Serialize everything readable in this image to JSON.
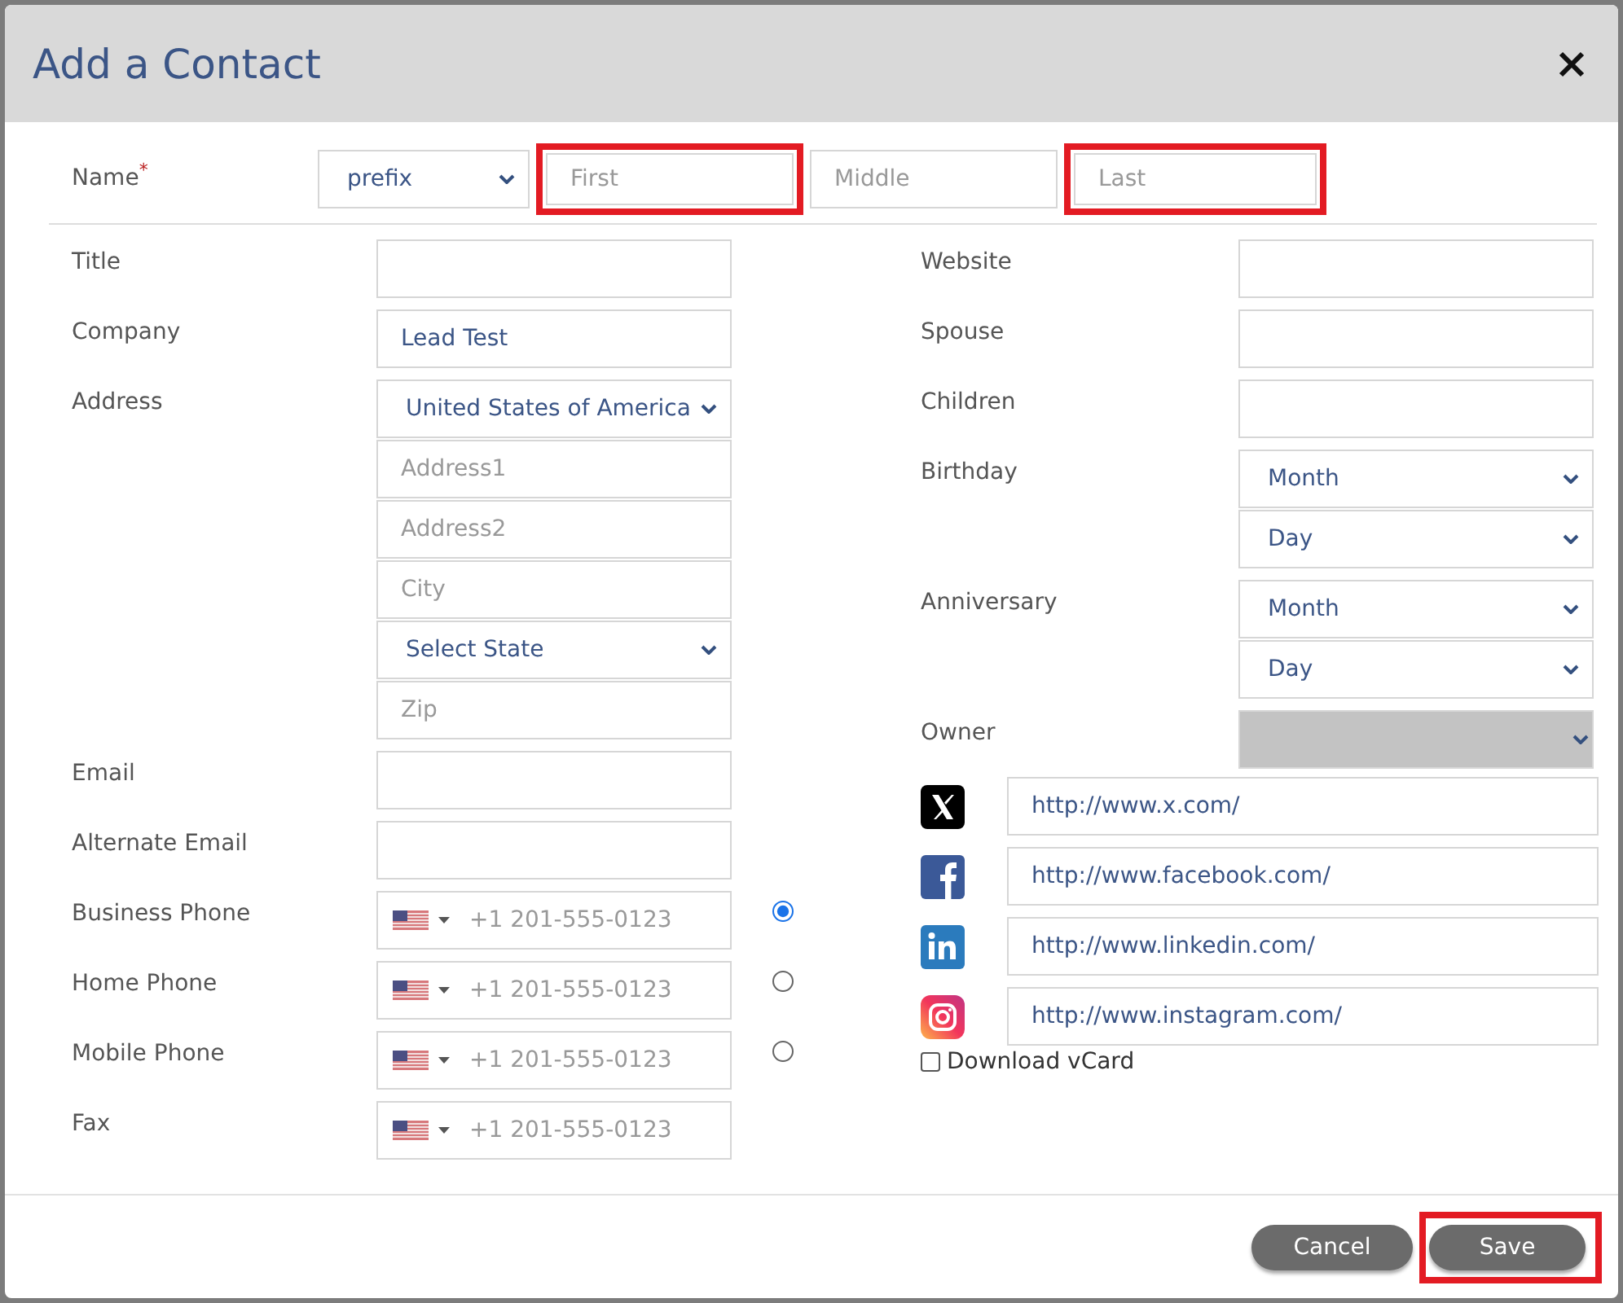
{
  "dialog": {
    "title": "Add a Contact"
  },
  "name_row": {
    "label": "Name",
    "required_mark": "*",
    "fields": [
      {
        "kind": "select",
        "value": "prefix",
        "highlighted": false
      },
      {
        "kind": "text",
        "placeholder": "First",
        "highlighted": true
      },
      {
        "kind": "text",
        "placeholder": "Middle",
        "highlighted": false
      },
      {
        "kind": "text",
        "placeholder": "Last",
        "highlighted": true
      }
    ]
  },
  "left_fields": [
    {
      "label": "Title",
      "controls": [
        {
          "kind": "text"
        }
      ]
    },
    {
      "label": "Company",
      "controls": [
        {
          "kind": "text",
          "value": "Lead Test"
        }
      ]
    },
    {
      "label": "Address",
      "controls": [
        {
          "kind": "select",
          "value": "United States of America"
        },
        {
          "kind": "text",
          "placeholder": "Address1"
        },
        {
          "kind": "text",
          "placeholder": "Address2"
        },
        {
          "kind": "text",
          "placeholder": "City"
        },
        {
          "kind": "select",
          "value": "Select State"
        },
        {
          "kind": "text",
          "placeholder": "Zip"
        }
      ]
    },
    {
      "label": "Email",
      "controls": [
        {
          "kind": "text"
        }
      ]
    },
    {
      "label": "Alternate Email",
      "controls": [
        {
          "kind": "text"
        }
      ]
    },
    {
      "label": "Business Phone",
      "controls": [
        {
          "kind": "phone",
          "placeholder": "+1 201-555-0123",
          "selected": true
        }
      ]
    },
    {
      "label": "Home Phone",
      "controls": [
        {
          "kind": "phone",
          "placeholder": "+1 201-555-0123",
          "selected": false
        }
      ]
    },
    {
      "label": "Mobile Phone",
      "controls": [
        {
          "kind": "phone",
          "placeholder": "+1 201-555-0123",
          "selected": false
        }
      ]
    },
    {
      "label": "Fax",
      "controls": [
        {
          "kind": "fax",
          "placeholder": "+1 201-555-0123"
        }
      ]
    }
  ],
  "right_fields": [
    {
      "label": "Website",
      "controls": [
        {
          "kind": "text"
        }
      ]
    },
    {
      "label": "Spouse",
      "controls": [
        {
          "kind": "text"
        }
      ]
    },
    {
      "label": "Children",
      "controls": [
        {
          "kind": "text"
        }
      ]
    },
    {
      "label": "Birthday",
      "controls": [
        {
          "kind": "select",
          "value": "Month"
        },
        {
          "kind": "select",
          "value": "Day"
        }
      ]
    },
    {
      "label": "Anniversary",
      "controls": [
        {
          "kind": "select",
          "value": "Month"
        },
        {
          "kind": "select",
          "value": "Day"
        }
      ]
    },
    {
      "label": "Owner",
      "controls": [
        {
          "kind": "select",
          "disabled": true
        }
      ]
    }
  ],
  "social_links": [
    {
      "kind": "x",
      "value": "http://www.x.com/"
    },
    {
      "kind": "facebook",
      "value": "http://www.facebook.com/"
    },
    {
      "kind": "linkedin",
      "value": "http://www.linkedin.com/"
    },
    {
      "kind": "instagram",
      "value": "http://www.instagram.com/"
    }
  ],
  "download_vcard": {
    "label": "Download vCard",
    "checked": false
  },
  "buttons": [
    {
      "label": "Cancel",
      "highlighted": false
    },
    {
      "label": "Save",
      "highlighted": true
    }
  ]
}
